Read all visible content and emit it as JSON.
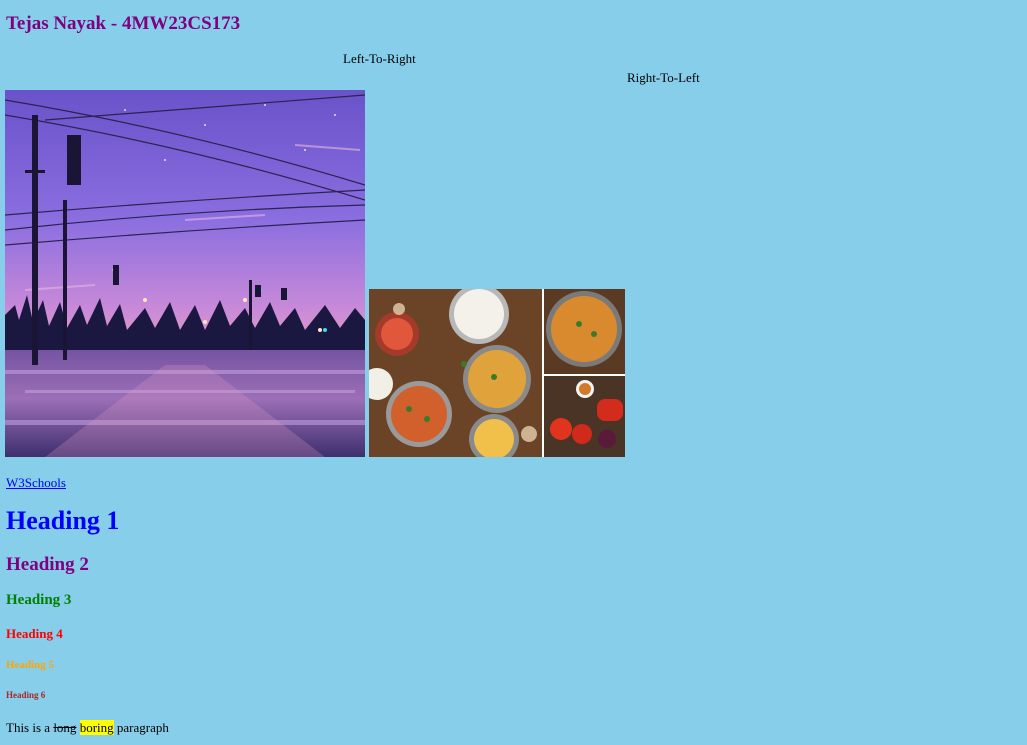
{
  "header": {
    "title": "Tejas Nayak - 4MW23CS173",
    "title_color": "#800080"
  },
  "bdo": {
    "left_to_right": "Left-To-Right",
    "right_to_left": "Right-To-Left"
  },
  "images": [
    {
      "name": "sunset-street-image",
      "description_icon": "image-icon"
    },
    {
      "name": "indian-food-image",
      "description_icon": "image-icon"
    }
  ],
  "link": {
    "text": "W3Schools"
  },
  "headings": [
    {
      "text": "Heading 1",
      "color": "#0000ff"
    },
    {
      "text": "Heading 2",
      "color": "#800080"
    },
    {
      "text": "Heading 3",
      "color": "#008000"
    },
    {
      "text": "Heading 4",
      "color": "#ff0000"
    },
    {
      "text": "Heading 5",
      "color": "#ffa500"
    },
    {
      "text": "Heading 6",
      "color": "#a52a2a"
    }
  ],
  "paragraph": {
    "prefix": "This is a ",
    "struck": "long",
    "space": " ",
    "highlighted": "boring",
    "suffix": " paragraph"
  },
  "colors": {
    "background": "#87ceeb",
    "link": "#0000ee",
    "highlight": "#ffff00"
  }
}
